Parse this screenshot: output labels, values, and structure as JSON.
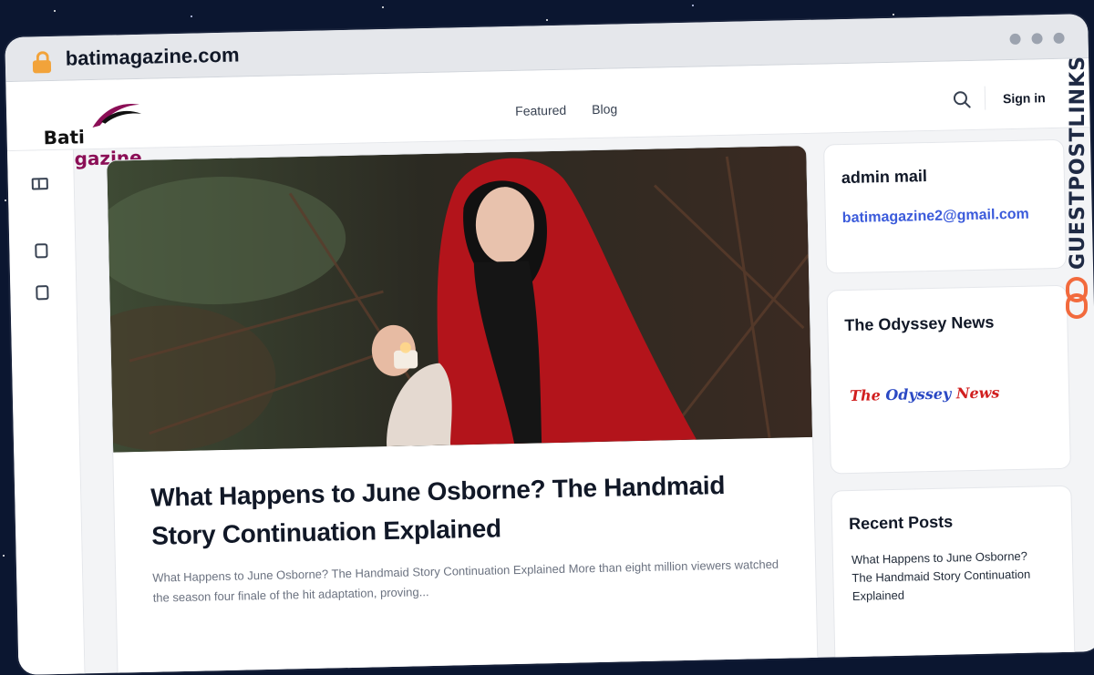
{
  "browser": {
    "url": "batimagazine.com"
  },
  "header": {
    "logo_word1": "Bati",
    "logo_word2": "Magazine",
    "nav": [
      "Featured",
      "Blog"
    ],
    "signin_label": "Sign in"
  },
  "post": {
    "title": "What Happens to June Osborne? The Handmaid Story Continuation Explained",
    "excerpt": "What Happens to June Osborne? The Handmaid Story Continuation Explained More than eight million viewers watched the season four finale of the hit adaptation, proving..."
  },
  "sidebar": {
    "admin_title": "admin mail",
    "admin_email": "batimagazine2@gmail.com",
    "odyssey_title": "The Odyssey News",
    "odyssey_logo_part1": "The ",
    "odyssey_logo_part2": "Odyssey",
    "odyssey_logo_part3": " News",
    "recent_title": "Recent Posts",
    "recent_posts": [
      "What Happens to June Osborne? The Handmaid Story Continuation Explained"
    ]
  },
  "badge": {
    "text": "GUESTPOSTLINKS"
  },
  "colors": {
    "accent_link": "#3b5bdb",
    "logo_magenta": "#8b0e56",
    "lock": "#f2a33a",
    "badge": "#1f2a44",
    "badge_icon": "#f26a3d"
  },
  "icons": [
    "lock-icon",
    "search-icon",
    "sidebar-toggle-icon",
    "page-icon",
    "link-icon"
  ]
}
